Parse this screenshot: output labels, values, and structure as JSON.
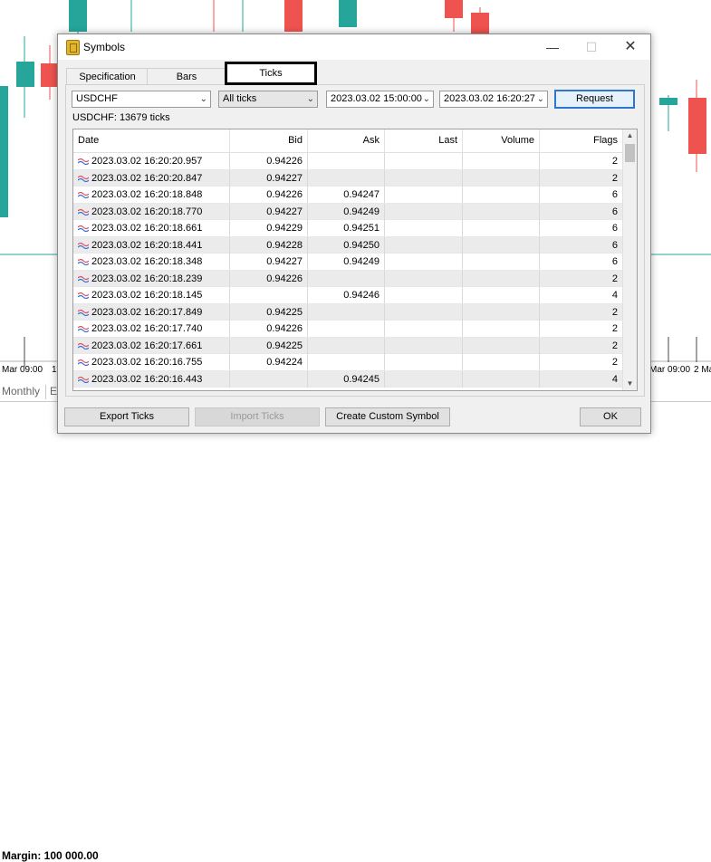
{
  "background": {
    "date_labels": [
      "Mar 09:00",
      "1",
      "Mar 09:00",
      "2 Ma"
    ],
    "timeframe_tab": "Monthly",
    "next_tab": "Ei",
    "status_margin": "Margin: 100 000.00"
  },
  "dialog": {
    "title": "Symbols",
    "tabs": [
      {
        "label": "Specification"
      },
      {
        "label": "Bars"
      },
      {
        "label": "Ticks"
      }
    ],
    "symbol_value": "USDCHF",
    "tick_type_value": "All ticks",
    "date_from_value": "2023.03.02 15:00:00",
    "date_to_value": "2023.03.02 16:20:27",
    "request_label": "Request",
    "summary": "USDCHF: 13679 ticks",
    "table": {
      "columns": [
        "Date",
        "Bid",
        "Ask",
        "Last",
        "Volume",
        "Flags"
      ],
      "rows": [
        {
          "date": "2023.03.02 16:20:20.957",
          "bid": "0.94226",
          "ask": "",
          "last": "",
          "volume": "",
          "flags": "2"
        },
        {
          "date": "2023.03.02 16:20:20.847",
          "bid": "0.94227",
          "ask": "",
          "last": "",
          "volume": "",
          "flags": "2"
        },
        {
          "date": "2023.03.02 16:20:18.848",
          "bid": "0.94226",
          "ask": "0.94247",
          "last": "",
          "volume": "",
          "flags": "6"
        },
        {
          "date": "2023.03.02 16:20:18.770",
          "bid": "0.94227",
          "ask": "0.94249",
          "last": "",
          "volume": "",
          "flags": "6"
        },
        {
          "date": "2023.03.02 16:20:18.661",
          "bid": "0.94229",
          "ask": "0.94251",
          "last": "",
          "volume": "",
          "flags": "6"
        },
        {
          "date": "2023.03.02 16:20:18.441",
          "bid": "0.94228",
          "ask": "0.94250",
          "last": "",
          "volume": "",
          "flags": "6"
        },
        {
          "date": "2023.03.02 16:20:18.348",
          "bid": "0.94227",
          "ask": "0.94249",
          "last": "",
          "volume": "",
          "flags": "6"
        },
        {
          "date": "2023.03.02 16:20:18.239",
          "bid": "0.94226",
          "ask": "",
          "last": "",
          "volume": "",
          "flags": "2"
        },
        {
          "date": "2023.03.02 16:20:18.145",
          "bid": "",
          "ask": "0.94246",
          "last": "",
          "volume": "",
          "flags": "4"
        },
        {
          "date": "2023.03.02 16:20:17.849",
          "bid": "0.94225",
          "ask": "",
          "last": "",
          "volume": "",
          "flags": "2"
        },
        {
          "date": "2023.03.02 16:20:17.740",
          "bid": "0.94226",
          "ask": "",
          "last": "",
          "volume": "",
          "flags": "2"
        },
        {
          "date": "2023.03.02 16:20:17.661",
          "bid": "0.94225",
          "ask": "",
          "last": "",
          "volume": "",
          "flags": "2"
        },
        {
          "date": "2023.03.02 16:20:16.755",
          "bid": "0.94224",
          "ask": "",
          "last": "",
          "volume": "",
          "flags": "2"
        },
        {
          "date": "2023.03.02 16:20:16.443",
          "bid": "",
          "ask": "0.94245",
          "last": "",
          "volume": "",
          "flags": "4"
        }
      ]
    },
    "buttons": {
      "export": "Export Ticks",
      "import": "Import Ticks",
      "custom": "Create Custom Symbol",
      "ok": "OK"
    }
  },
  "colors": {
    "bull_candle": "#26a69a",
    "bear_candle": "#ef5350",
    "highlight_outline": "#000000",
    "focus_button": "#2f76d2"
  }
}
